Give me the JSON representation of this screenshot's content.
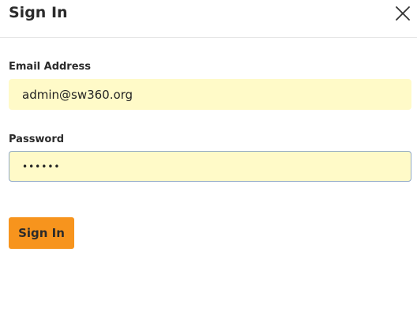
{
  "dialog": {
    "title": "Sign In",
    "close_icon": "close-icon"
  },
  "form": {
    "email": {
      "label": "Email Address",
      "value": "admin@sw360.org"
    },
    "password": {
      "label": "Password",
      "value": "••••••"
    },
    "submit_label": "Sign In"
  },
  "colors": {
    "accent": "#f7941d",
    "input_fill": "#fffac8",
    "focus_border": "#8fa8c6"
  }
}
